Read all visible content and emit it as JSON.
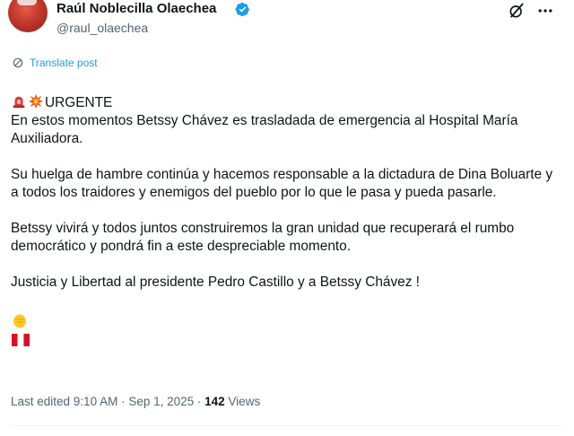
{
  "author": {
    "display_name": "Raúl Noblecilla Olaechea",
    "handle": "@raul_olaechea"
  },
  "translate_label": "Translate post",
  "post": {
    "line1": "URGENTE",
    "para1": "En estos momentos  Betssy Chávez es trasladada de emergencia al Hospital María Auxiliadora.",
    "para2": "Su huelga de hambre continúa y hacemos responsable a la dictadura de Dina Boluarte y a todos los traidores y enemigos del pueblo por lo que le pasa y pueda pasarle.",
    "para3": "Betssy vivirá y todos juntos construiremos la gran unidad que recuperará el rumbo democrático y pondrá fin a este despreciable momento.",
    "para4": "Justicia y Libertad al presidente Pedro Castillo y a Betssy Chávez !"
  },
  "meta": {
    "edited": "Last edited 9:10 AM · Sep 1, 2025 · ",
    "views_count": "142",
    "views_label": " Views"
  },
  "icons": [
    "avatar",
    "verified-icon",
    "grok-icon",
    "more-icon",
    "translate-icon",
    "siren-icon",
    "collision-icon",
    "fist-icon",
    "peru-flag-icon"
  ],
  "colors": {
    "accent": "#1d9bf0",
    "secondary_text": "#536471",
    "text": "#0f1419"
  }
}
